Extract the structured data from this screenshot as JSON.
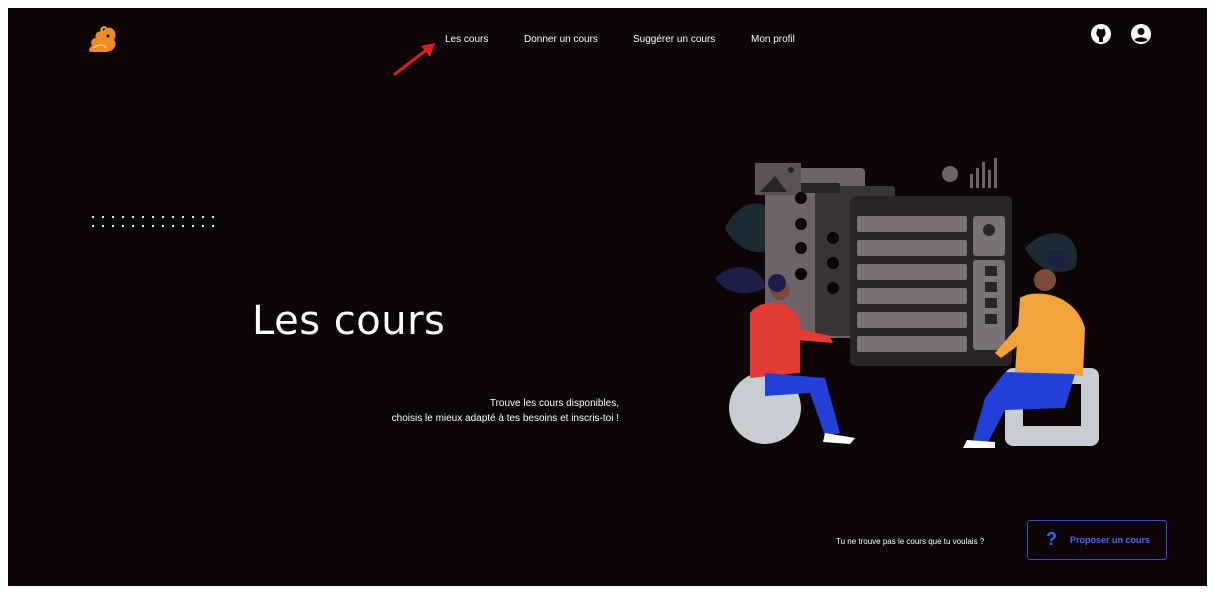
{
  "nav": {
    "items": [
      {
        "label": "Les cours"
      },
      {
        "label": "Donner un cours"
      },
      {
        "label": "Suggérer un cours"
      },
      {
        "label": "Mon profil"
      }
    ]
  },
  "header": {
    "logo_icon": "squirrel-logo-icon",
    "github_icon": "github-icon",
    "profile_icon": "user-circle-icon"
  },
  "hero": {
    "title": "Les cours",
    "subtitle_line1": "Trouve les cours disponibles,",
    "subtitle_line2": "choisis le mieux adapté à tes besoins et inscris-toi !"
  },
  "footer_cta": {
    "question": "Tu ne trouve pas le cours que tu voulais ?",
    "button_icon": "question-mark-icon",
    "button_label": "Proposer un cours"
  },
  "colors": {
    "background": "#0d0406",
    "accent_blue": "#4262f0",
    "annotation_arrow": "#e0191e",
    "logo_orange": "#f08a24"
  }
}
